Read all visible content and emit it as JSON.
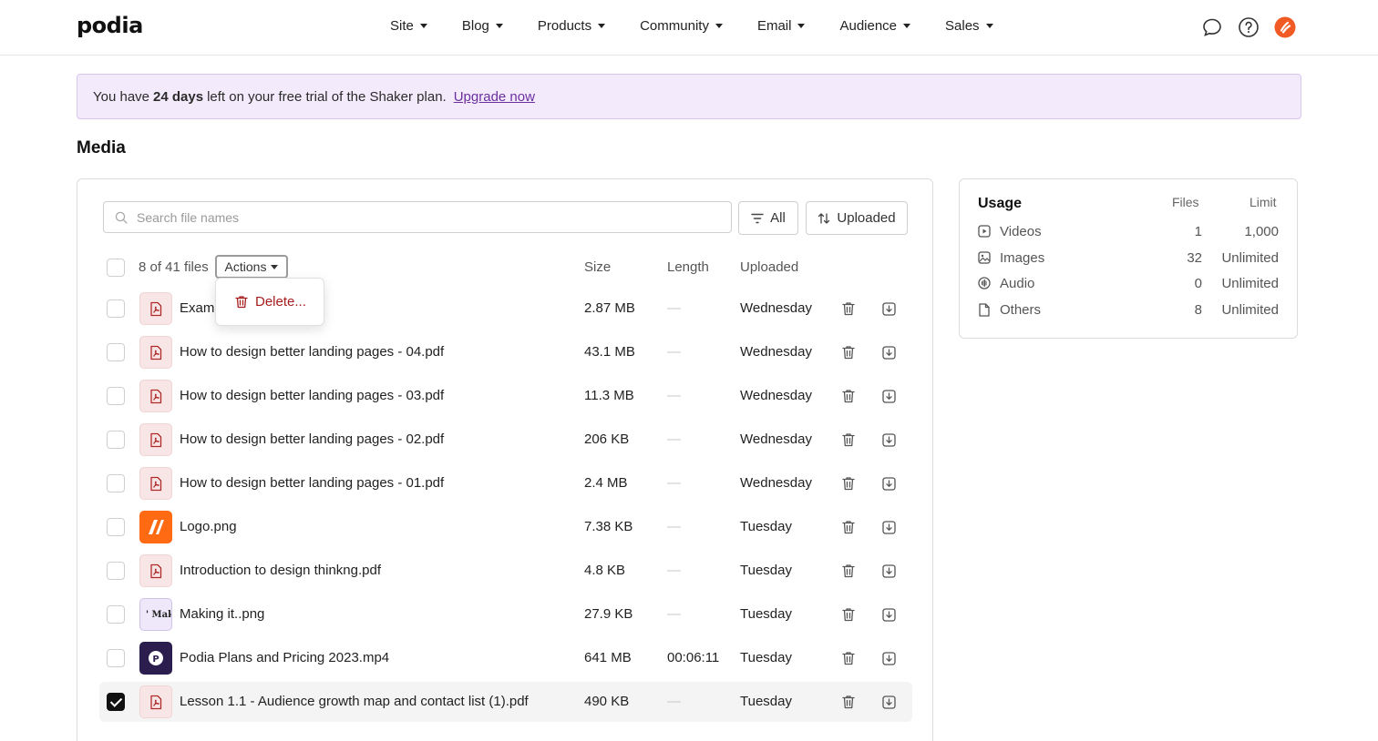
{
  "brand": {
    "logo": "podia"
  },
  "nav": [
    {
      "label": "Site"
    },
    {
      "label": "Blog"
    },
    {
      "label": "Products"
    },
    {
      "label": "Community"
    },
    {
      "label": "Email"
    },
    {
      "label": "Audience"
    },
    {
      "label": "Sales"
    }
  ],
  "header_icons": [
    "chat-icon",
    "help-icon",
    "account-avatar"
  ],
  "banner": {
    "prefix": "You have",
    "days": "24 days",
    "suffix": "left on your free trial of the Shaker plan.",
    "link": "Upgrade now"
  },
  "page_title": "Media",
  "media": {
    "search_placeholder": "Search file names",
    "filter_label": "All",
    "sort_label": "Uploaded",
    "files_count": "8 of 41 files",
    "actions_label": "Actions",
    "columns": {
      "size": "Size",
      "length": "Length",
      "uploaded": "Uploaded"
    },
    "dropdown": {
      "delete_label": "Delete..."
    },
    "rows": [
      {
        "name": "Examp",
        "size": "2.87 MB",
        "length": "—",
        "uploaded": "Wednesday",
        "type": "pdf",
        "checked": false
      },
      {
        "name": "How to design better landing pages - 04.pdf",
        "size": "43.1 MB",
        "length": "—",
        "uploaded": "Wednesday",
        "type": "pdf",
        "checked": false
      },
      {
        "name": "How to design better landing pages - 03.pdf",
        "size": "11.3 MB",
        "length": "—",
        "uploaded": "Wednesday",
        "type": "pdf",
        "checked": false
      },
      {
        "name": "How to design better landing pages - 02.pdf",
        "size": "206 KB",
        "length": "—",
        "uploaded": "Wednesday",
        "type": "pdf",
        "checked": false
      },
      {
        "name": "How to design better landing pages - 01.pdf",
        "size": "2.4 MB",
        "length": "—",
        "uploaded": "Wednesday",
        "type": "pdf",
        "checked": false
      },
      {
        "name": "Logo.png",
        "size": "7.38 KB",
        "length": "—",
        "uploaded": "Tuesday",
        "type": "logo",
        "checked": false
      },
      {
        "name": "Introduction to design thinkng.pdf",
        "size": "4.8 KB",
        "length": "—",
        "uploaded": "Tuesday",
        "type": "pdf",
        "checked": false
      },
      {
        "name": "Making it..png",
        "size": "27.9 KB",
        "length": "—",
        "uploaded": "Tuesday",
        "type": "making",
        "thumb_text": "' Makin",
        "checked": false
      },
      {
        "name": "Podia Plans and Pricing 2023.mp4",
        "size": "641 MB",
        "length": "00:06:11",
        "uploaded": "Tuesday",
        "type": "video",
        "checked": false
      },
      {
        "name": "Lesson 1.1 - Audience growth map and contact list (1).pdf",
        "size": "490 KB",
        "length": "—",
        "uploaded": "Tuesday",
        "type": "pdf",
        "checked": true
      }
    ]
  },
  "usage": {
    "title": "Usage",
    "col_files": "Files",
    "col_limit": "Limit",
    "rows": [
      {
        "label": "Videos",
        "icon": "video-icon",
        "files": "1",
        "limit": "1,000"
      },
      {
        "label": "Images",
        "icon": "image-icon",
        "files": "32",
        "limit": "Unlimited"
      },
      {
        "label": "Audio",
        "icon": "audio-icon",
        "files": "0",
        "limit": "Unlimited"
      },
      {
        "label": "Others",
        "icon": "file-icon",
        "files": "8",
        "limit": "Unlimited"
      }
    ]
  },
  "colors": {
    "accent_purple": "#6b2fa0",
    "banner_bg": "#f3eafb",
    "danger": "#a51d1d",
    "logo_orange": "#ff6a13"
  }
}
